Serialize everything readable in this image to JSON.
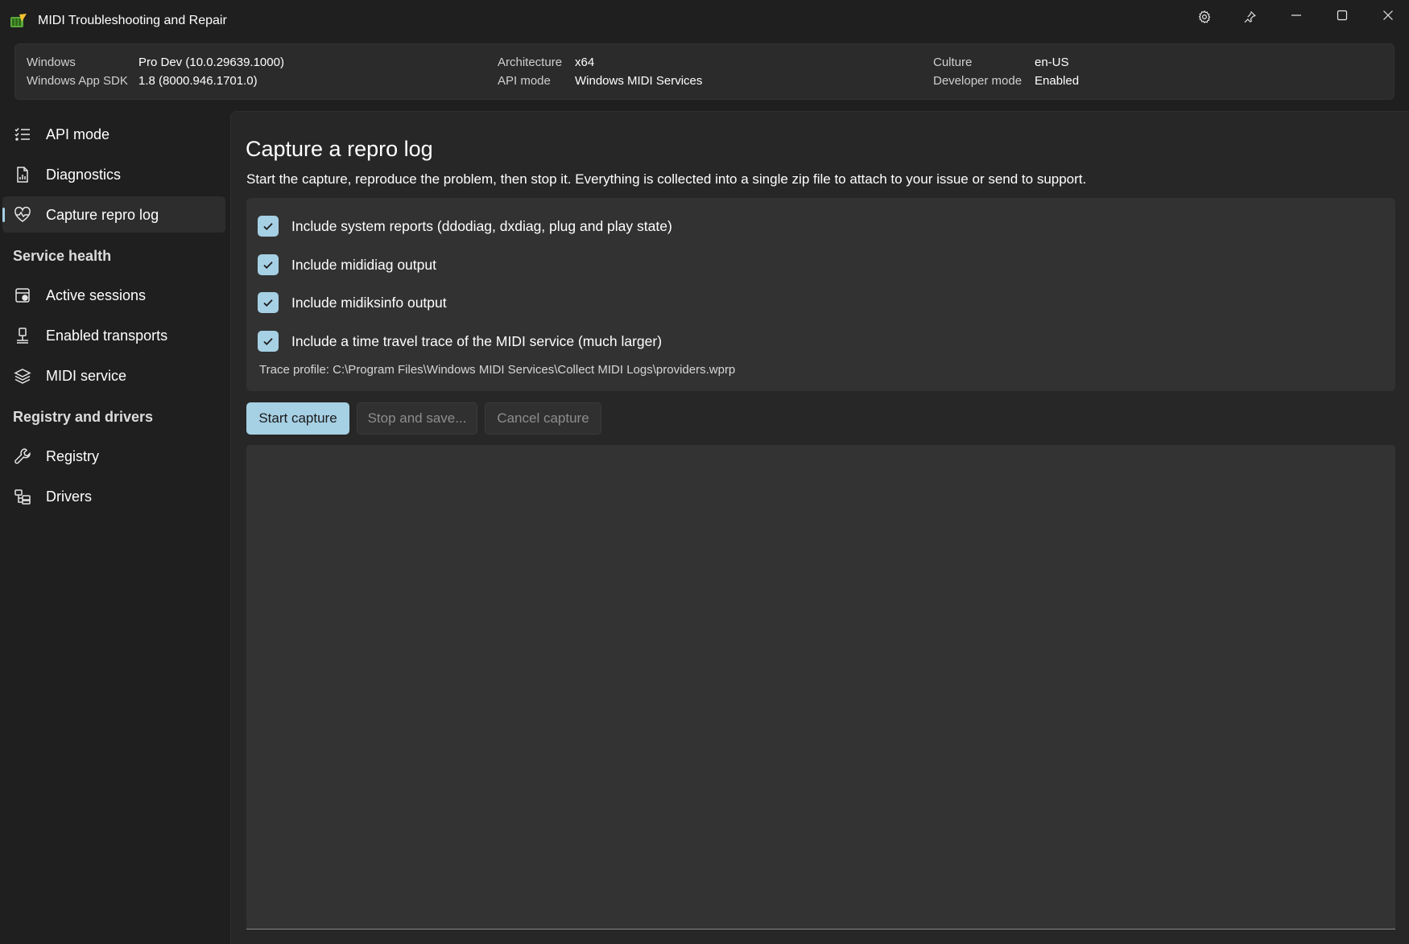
{
  "window": {
    "title": "MIDI Troubleshooting and Repair"
  },
  "info": {
    "windows_label": "Windows",
    "windows_value": "Pro Dev (10.0.29639.1000)",
    "sdk_label": "Windows App SDK",
    "sdk_value": "1.8 (8000.946.1701.0)",
    "arch_label": "Architecture",
    "arch_value": "x64",
    "api_label": "API mode",
    "api_value": "Windows MIDI Services",
    "culture_label": "Culture",
    "culture_value": "en-US",
    "devmode_label": "Developer mode",
    "devmode_value": "Enabled"
  },
  "sidebar": {
    "items": [
      {
        "label": "API mode",
        "icon": "checklist-icon"
      },
      {
        "label": "Diagnostics",
        "icon": "report-icon"
      },
      {
        "label": "Capture repro log",
        "icon": "heartbeat-icon",
        "selected": true
      }
    ],
    "section_service_health": "Service health",
    "service_items": [
      {
        "label": "Active sessions",
        "icon": "sessions-icon"
      },
      {
        "label": "Enabled transports",
        "icon": "transport-icon"
      },
      {
        "label": "MIDI service",
        "icon": "layers-icon"
      }
    ],
    "section_registry": "Registry and drivers",
    "registry_items": [
      {
        "label": "Registry",
        "icon": "wrench-icon"
      },
      {
        "label": "Drivers",
        "icon": "drivers-icon"
      }
    ]
  },
  "main": {
    "title": "Capture a repro log",
    "description": "Start the capture, reproduce the problem, then stop it. Everything is collected into a single zip file to attach to your issue or send to support.",
    "options": [
      {
        "label": "Include system reports (ddodiag, dxdiag, plug and play state)",
        "checked": true
      },
      {
        "label": "Include mididiag output",
        "checked": true
      },
      {
        "label": "Include midiksinfo output",
        "checked": true
      },
      {
        "label": "Include a time travel trace of the MIDI service (much larger)",
        "checked": true
      }
    ],
    "trace_profile": "Trace profile: C:\\Program Files\\Windows MIDI Services\\Collect MIDI Logs\\providers.wprp",
    "buttons": {
      "start": "Start capture",
      "stop": "Stop and save...",
      "cancel": "Cancel capture"
    }
  },
  "colors": {
    "accent": "#a6d0e4",
    "background": "#1f1f1f",
    "card": "#323232"
  }
}
